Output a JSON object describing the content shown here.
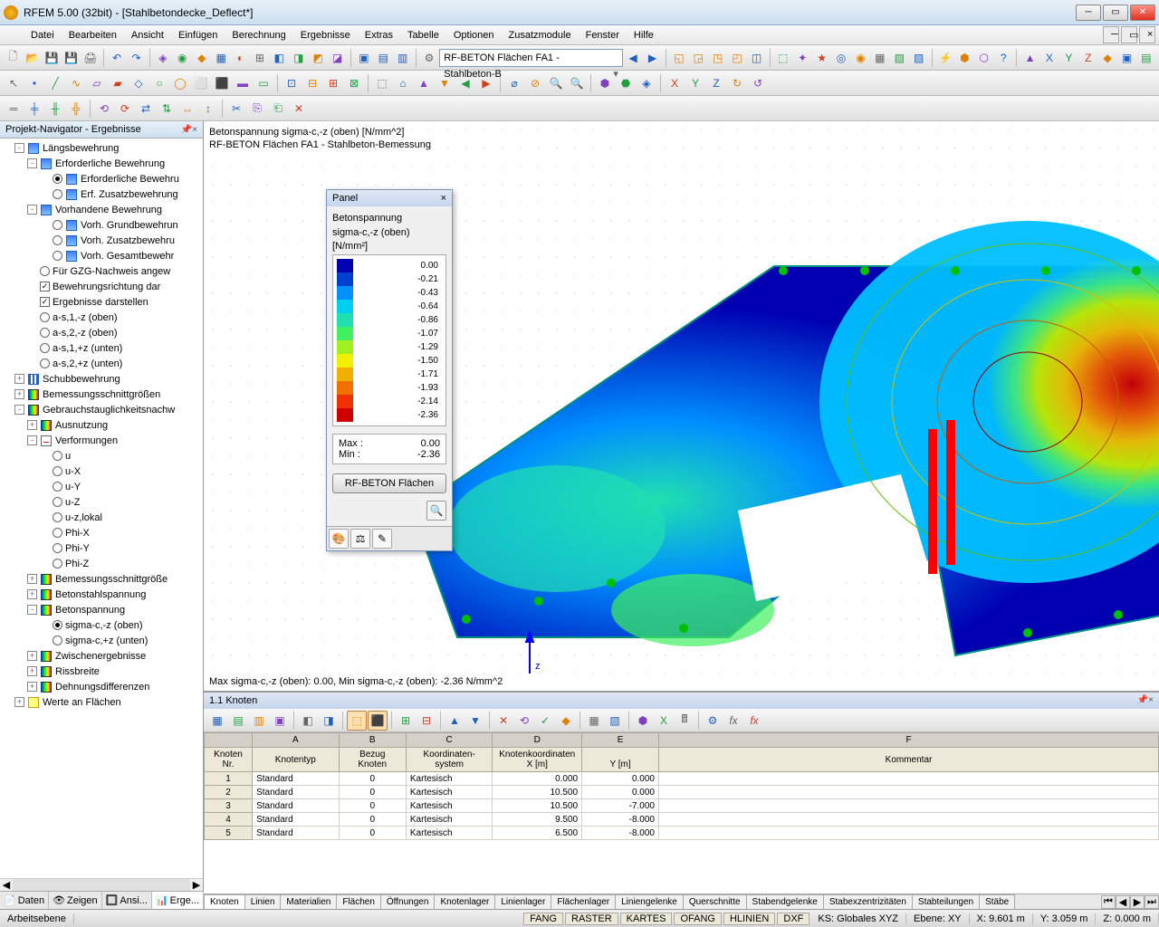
{
  "app": {
    "title": "RFEM 5.00 (32bit) - [Stahlbetondecke_Deflect*]"
  },
  "menu": [
    "Datei",
    "Bearbeiten",
    "Ansicht",
    "Einfügen",
    "Berechnung",
    "Ergebnisse",
    "Extras",
    "Tabelle",
    "Optionen",
    "Zusatzmodule",
    "Fenster",
    "Hilfe"
  ],
  "toolbar_combo": "RF-BETON Flächen FA1 - Stahlbeton-B",
  "navigator": {
    "title": "Projekt-Navigator - Ergebnisse",
    "tabs": [
      "Daten",
      "Zeigen",
      "Ansi...",
      "Erge..."
    ],
    "tree": [
      {
        "lvl": 1,
        "exp": "-",
        "icon": "bars",
        "label": "Längsbewehrung"
      },
      {
        "lvl": 2,
        "exp": "-",
        "icon": "bars",
        "label": "Erforderliche Bewehrung"
      },
      {
        "lvl": 3,
        "radio": true,
        "sel": true,
        "icon": "bars",
        "label": "Erforderliche Bewehru"
      },
      {
        "lvl": 3,
        "radio": true,
        "icon": "bars",
        "label": "Erf. Zusatzbewehrung"
      },
      {
        "lvl": 2,
        "exp": "-",
        "icon": "bars",
        "label": "Vorhandene Bewehrung"
      },
      {
        "lvl": 3,
        "radio": true,
        "icon": "bars",
        "label": "Vorh. Grundbewehrun"
      },
      {
        "lvl": 3,
        "radio": true,
        "icon": "bars",
        "label": "Vorh. Zusatzbewehru"
      },
      {
        "lvl": 3,
        "radio": true,
        "icon": "bars",
        "label": "Vorh. Gesamtbewehr"
      },
      {
        "lvl": 2,
        "radio": true,
        "label": "Für GZG-Nachweis angew"
      },
      {
        "lvl": 2,
        "check": true,
        "sel": true,
        "label": "Bewehrungsrichtung dar"
      },
      {
        "lvl": 2,
        "check": true,
        "sel": true,
        "label": "Ergebnisse darstellen"
      },
      {
        "lvl": 2,
        "radio": true,
        "label": "a-s,1,-z (oben)"
      },
      {
        "lvl": 2,
        "radio": true,
        "label": "a-s,2,-z (oben)"
      },
      {
        "lvl": 2,
        "radio": true,
        "label": "a-s,1,+z (unten)"
      },
      {
        "lvl": 2,
        "radio": true,
        "label": "a-s,2,+z (unten)"
      },
      {
        "lvl": 1,
        "exp": "+",
        "icon": "sch",
        "label": "Schubbewehrung"
      },
      {
        "lvl": 1,
        "exp": "+",
        "icon": "heat",
        "label": "Bemessungsschnittgrößen"
      },
      {
        "lvl": 1,
        "exp": "-",
        "icon": "heat",
        "label": "Gebrauchstauglichkeitsnachw"
      },
      {
        "lvl": 2,
        "exp": "+",
        "icon": "heat",
        "label": "Ausnutzung"
      },
      {
        "lvl": 2,
        "exp": "-",
        "icon": "def",
        "label": "Verformungen"
      },
      {
        "lvl": 3,
        "radio": true,
        "label": "u"
      },
      {
        "lvl": 3,
        "radio": true,
        "label": "u-X"
      },
      {
        "lvl": 3,
        "radio": true,
        "label": "u-Y"
      },
      {
        "lvl": 3,
        "radio": true,
        "label": "u-Z"
      },
      {
        "lvl": 3,
        "radio": true,
        "label": "u-z,lokal"
      },
      {
        "lvl": 3,
        "radio": true,
        "label": "Phi-X"
      },
      {
        "lvl": 3,
        "radio": true,
        "label": "Phi-Y"
      },
      {
        "lvl": 3,
        "radio": true,
        "label": "Phi-Z"
      },
      {
        "lvl": 2,
        "exp": "+",
        "icon": "heat",
        "label": "Bemessungsschnittgröße"
      },
      {
        "lvl": 2,
        "exp": "+",
        "icon": "heat",
        "label": "Betonstahlspannung"
      },
      {
        "lvl": 2,
        "exp": "-",
        "icon": "heat",
        "label": "Betonspannung"
      },
      {
        "lvl": 3,
        "radio": true,
        "sel": true,
        "label": "sigma-c,-z (oben)"
      },
      {
        "lvl": 3,
        "radio": true,
        "label": "sigma-c,+z (unten)"
      },
      {
        "lvl": 2,
        "exp": "+",
        "icon": "heat",
        "label": "Zwischenergebnisse"
      },
      {
        "lvl": 2,
        "exp": "+",
        "icon": "heat",
        "label": "Rissbreite"
      },
      {
        "lvl": 2,
        "exp": "+",
        "icon": "heat",
        "label": "Dehnungsdifferenzen"
      },
      {
        "lvl": 1,
        "exp": "+",
        "icon": "tab",
        "label": "Werte an Flächen"
      }
    ]
  },
  "viewport": {
    "line1": "Betonspannung sigma-c,-z (oben) [N/mm^2]",
    "line2": "RF-BETON Flächen FA1 - Stahlbeton-Bemessung",
    "bottom": "Max sigma-c,-z (oben): 0.00, Min sigma-c,-z (oben): -2.36 N/mm^2",
    "axis_z": "z"
  },
  "panel": {
    "title": "Panel",
    "subtitle1": "Betonspannung",
    "subtitle2": "sigma-c,-z (oben) [N/mm²]",
    "legend": [
      {
        "c": "#0000b0",
        "v": "0.00"
      },
      {
        "c": "#0040d0",
        "v": "-0.21"
      },
      {
        "c": "#0090ff",
        "v": "-0.43"
      },
      {
        "c": "#00d0f0",
        "v": "-0.64"
      },
      {
        "c": "#20e0b0",
        "v": "-0.86"
      },
      {
        "c": "#40f060",
        "v": "-1.07"
      },
      {
        "c": "#a0f020",
        "v": "-1.29"
      },
      {
        "c": "#f0f000",
        "v": "-1.50"
      },
      {
        "c": "#f0b000",
        "v": "-1.71"
      },
      {
        "c": "#f07000",
        "v": "-1.93"
      },
      {
        "c": "#f03000",
        "v": "-2.14"
      },
      {
        "c": "#d00000",
        "v": "-2.36"
      }
    ],
    "max_label": "Max :",
    "max_val": "0.00",
    "min_label": "Min :",
    "min_val": "-2.36",
    "button": "RF-BETON Flächen"
  },
  "grid": {
    "title": "1.1 Knoten",
    "headers_top": [
      "",
      "A",
      "B",
      "C",
      "D",
      "E",
      "F"
    ],
    "headers": [
      "Knoten\nNr.",
      "Knotentyp",
      "Bezug\nKnoten",
      "Koordinaten-\nsystem",
      "Knotenkoordinaten\nX [m]",
      "\nY [m]",
      "Kommentar"
    ],
    "rows": [
      [
        "1",
        "Standard",
        "0",
        "Kartesisch",
        "0.000",
        "0.000",
        ""
      ],
      [
        "2",
        "Standard",
        "0",
        "Kartesisch",
        "10.500",
        "0.000",
        ""
      ],
      [
        "3",
        "Standard",
        "0",
        "Kartesisch",
        "10.500",
        "-7.000",
        ""
      ],
      [
        "4",
        "Standard",
        "0",
        "Kartesisch",
        "9.500",
        "-8.000",
        ""
      ],
      [
        "5",
        "Standard",
        "0",
        "Kartesisch",
        "6.500",
        "-8.000",
        ""
      ]
    ],
    "tabs": [
      "Knoten",
      "Linien",
      "Materialien",
      "Flächen",
      "Öffnungen",
      "Knotenlager",
      "Linienlager",
      "Flächenlager",
      "Liniengelenke",
      "Querschnitte",
      "Stabendgelenke",
      "Stabexzentrizitäten",
      "Stabteilungen",
      "Stäbe"
    ]
  },
  "status": {
    "left": "Arbeitsebene",
    "toggles": [
      "FANG",
      "RASTER",
      "KARTES",
      "OFANG",
      "HLINIEN",
      "DXF"
    ],
    "ks": "KS: Globales XYZ",
    "ebene": "Ebene: XY",
    "x": "X: 9.601 m",
    "y": "Y: 3.059 m",
    "z": "Z: 0.000 m"
  }
}
